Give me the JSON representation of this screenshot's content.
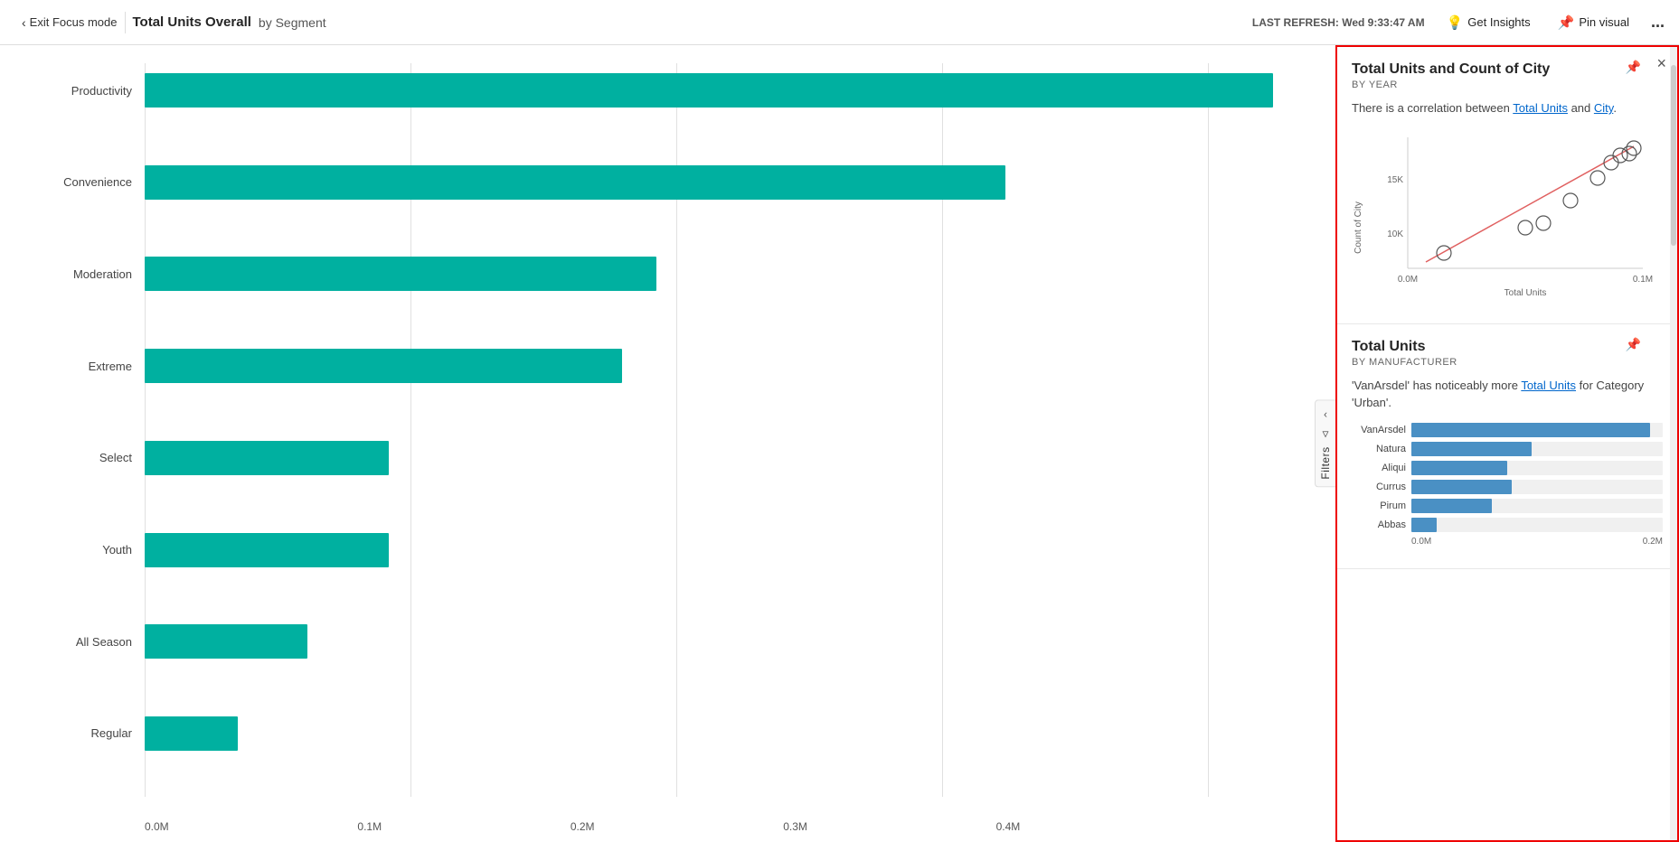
{
  "header": {
    "exit_focus_label": "Exit Focus mode",
    "page_title": "Total Units Overall",
    "page_title_by": "by Segment",
    "last_refresh_label": "LAST REFRESH:",
    "last_refresh_value": "Wed 9:33:47 AM",
    "get_insights_label": "Get Insights",
    "pin_visual_label": "Pin visual",
    "more_options": "..."
  },
  "chart": {
    "bars": [
      {
        "label": "Productivity",
        "value": 0.42,
        "width_pct": 97
      },
      {
        "label": "Convenience",
        "value": 0.32,
        "width_pct": 74
      },
      {
        "label": "Moderation",
        "value": 0.19,
        "width_pct": 44
      },
      {
        "label": "Extreme",
        "value": 0.18,
        "width_pct": 41
      },
      {
        "label": "Select",
        "value": 0.09,
        "width_pct": 21
      },
      {
        "label": "Youth",
        "value": 0.09,
        "width_pct": 21
      },
      {
        "label": "All Season",
        "value": 0.06,
        "width_pct": 14
      },
      {
        "label": "Regular",
        "value": 0.04,
        "width_pct": 8
      }
    ],
    "x_labels": [
      "0.0M",
      "0.1M",
      "0.2M",
      "0.3M",
      "0.4M"
    ],
    "filters_label": "Filters"
  },
  "insights_panel": {
    "close_label": "×",
    "card1": {
      "title": "Total Units and Count of City",
      "subtitle": "BY YEAR",
      "description_before": "There is a correlation between ",
      "description_link1": "Total Units",
      "description_mid": " and ",
      "description_link2": "City",
      "description_after": ".",
      "scatter": {
        "x_axis_label": "Total Units",
        "y_axis_label": "Count of City",
        "x_labels": [
          "0.0M",
          "0.1M"
        ],
        "y_labels": [
          "10K",
          "15K"
        ]
      }
    },
    "card2": {
      "title": "Total Units",
      "subtitle": "BY MANUFACTURER",
      "description_before": "'VanArsdel' has noticeably more ",
      "description_link": "Total Units",
      "description_after": " for Category 'Urban'.",
      "bars": [
        {
          "label": "VanArsdel",
          "width_pct": 95
        },
        {
          "label": "Natura",
          "width_pct": 48
        },
        {
          "label": "Aliqui",
          "width_pct": 38
        },
        {
          "label": "Currus",
          "width_pct": 40
        },
        {
          "label": "Pirum",
          "width_pct": 32
        },
        {
          "label": "Abbas",
          "width_pct": 10
        }
      ],
      "x_labels": [
        "0.0M",
        "0.2M"
      ]
    }
  }
}
